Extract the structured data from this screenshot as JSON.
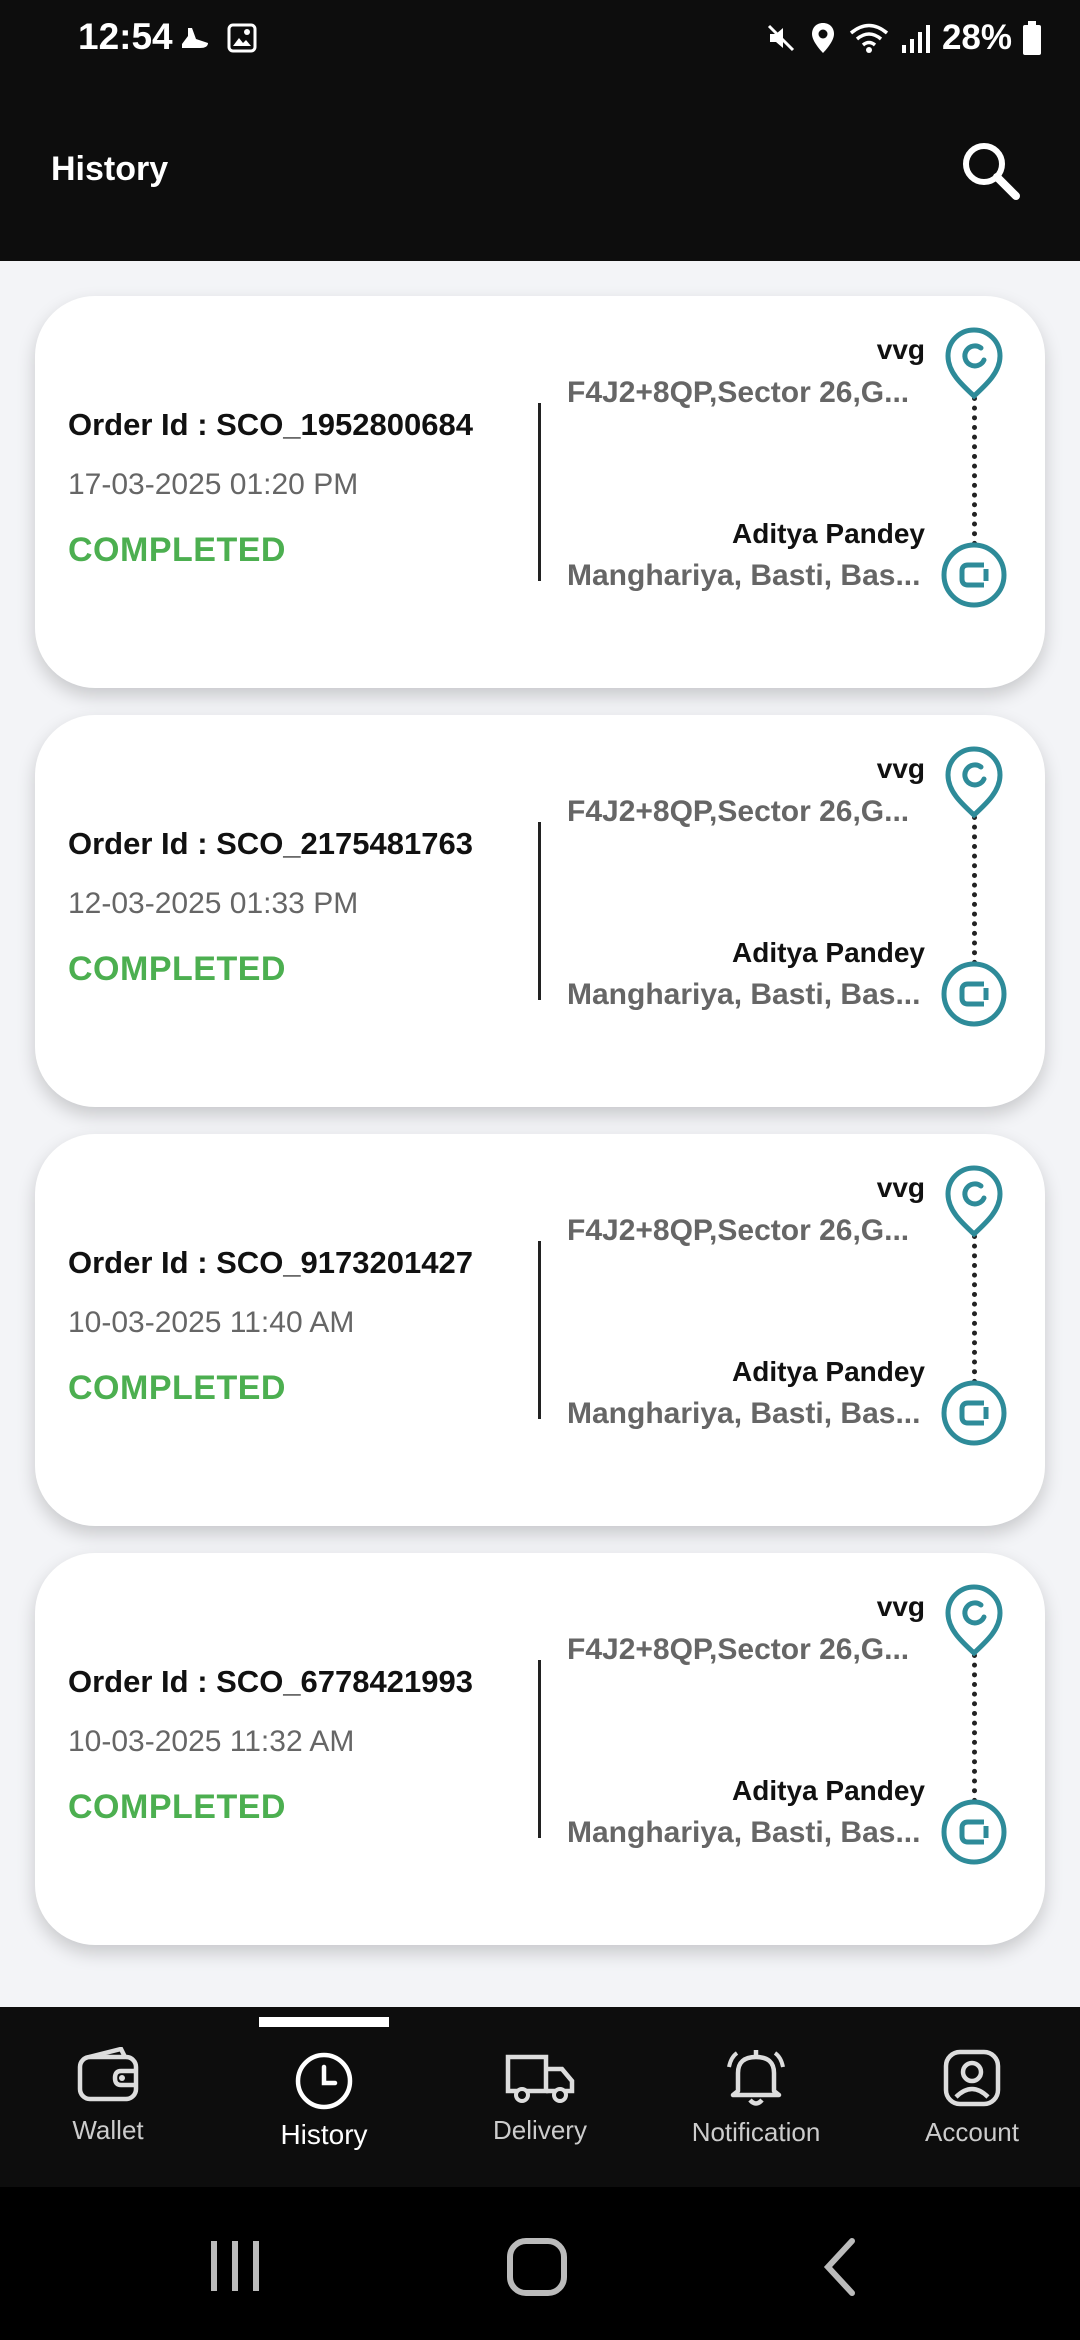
{
  "status_bar": {
    "time": "12:54",
    "battery": "28%"
  },
  "app_bar": {
    "title": "History"
  },
  "orders": [
    {
      "order_id": "Order Id : SCO_1952800684",
      "date": "17-03-2025 01:20 PM",
      "status": "COMPLETED",
      "pickup_name": "vvg",
      "pickup_address": "F4J2+8QP,Sector 26,G...",
      "drop_name": "Aditya Pandey",
      "drop_address": "Manghariya, Basti, Bas..."
    },
    {
      "order_id": "Order Id : SCO_2175481763",
      "date": "12-03-2025 01:33 PM",
      "status": "COMPLETED",
      "pickup_name": "vvg",
      "pickup_address": "F4J2+8QP,Sector 26,G...",
      "drop_name": "Aditya Pandey",
      "drop_address": "Manghariya, Basti, Bas..."
    },
    {
      "order_id": "Order Id : SCO_9173201427",
      "date": "10-03-2025 11:40 AM",
      "status": "COMPLETED",
      "pickup_name": "vvg",
      "pickup_address": "F4J2+8QP,Sector 26,G...",
      "drop_name": "Aditya Pandey",
      "drop_address": "Manghariya, Basti, Bas..."
    },
    {
      "order_id": "Order Id : SCO_6778421993",
      "date": "10-03-2025 11:32 AM",
      "status": "COMPLETED",
      "pickup_name": "vvg",
      "pickup_address": "F4J2+8QP,Sector 26,G...",
      "drop_name": "Aditya Pandey",
      "drop_address": "Manghariya, Basti, Bas..."
    }
  ],
  "bottom_nav": {
    "items": [
      {
        "label": "Wallet",
        "icon": "wallet-icon"
      },
      {
        "label": "History",
        "icon": "history-icon",
        "active": true
      },
      {
        "label": "Delivery",
        "icon": "delivery-truck-icon"
      },
      {
        "label": "Notification",
        "icon": "bell-icon"
      },
      {
        "label": "Account",
        "icon": "account-icon"
      }
    ]
  },
  "colors": {
    "app_bar": "#0d0d0d",
    "status_completed": "#4caf50",
    "route_icon": "#2e8b99",
    "background": "#f3f4f7"
  }
}
